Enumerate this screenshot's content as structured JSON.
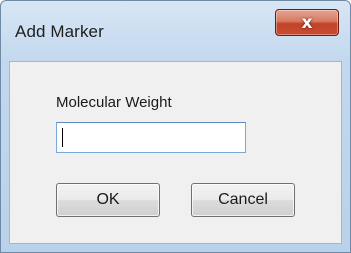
{
  "window": {
    "title": "Add Marker",
    "close_glyph": "x",
    "close_icon": "close-icon"
  },
  "form": {
    "field_label": "Molecular Weight",
    "field_value": "",
    "field_placeholder": ""
  },
  "buttons": {
    "ok_label": "OK",
    "cancel_label": "Cancel"
  },
  "colors": {
    "close_button": "#c94b30",
    "input_border": "#7aa7d8",
    "frame": "#c3d8ee"
  }
}
